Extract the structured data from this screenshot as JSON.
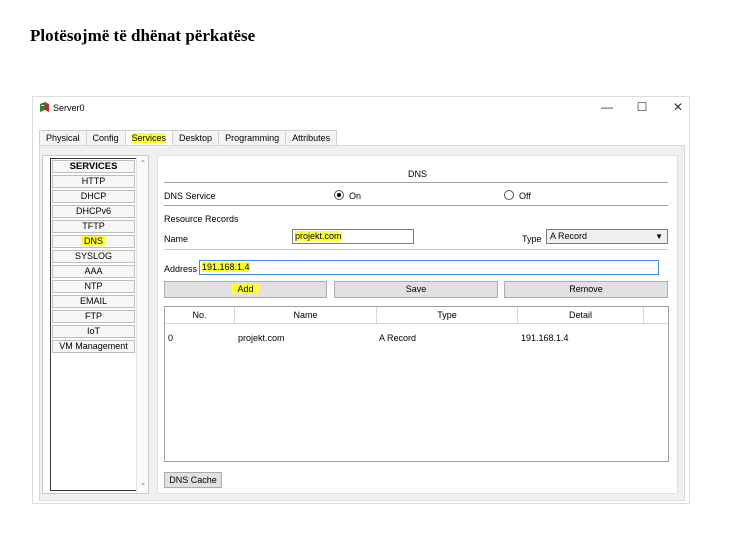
{
  "heading": "Plotësojmë të dhënat përkatëse",
  "window": {
    "title": "Server0",
    "minimize": "—",
    "maximize": "☐",
    "close": "✕"
  },
  "tabs": [
    "Physical",
    "Config",
    "Services",
    "Desktop",
    "Programming",
    "Attributes"
  ],
  "active_tab": "Services",
  "services": {
    "header": "SERVICES",
    "items": [
      "HTTP",
      "DHCP",
      "DHCPv6",
      "TFTP",
      "DNS",
      "SYSLOG",
      "AAA",
      "NTP",
      "EMAIL",
      "FTP",
      "IoT",
      "VM Management"
    ],
    "selected": "DNS"
  },
  "dns": {
    "title": "DNS",
    "service_label": "DNS Service",
    "on_label": "On",
    "off_label": "Off",
    "state": "On",
    "resource_records_label": "Resource Records",
    "name_label": "Name",
    "name_value": "projekt.com",
    "type_label": "Type",
    "type_value": "A Record",
    "address_label": "Address",
    "address_value": "191.168.1.4",
    "add_button": "Add",
    "save_button": "Save",
    "remove_button": "Remove",
    "table": {
      "columns": [
        "No.",
        "Name",
        "Type",
        "Detail"
      ],
      "rows": [
        [
          "0",
          "projekt.com",
          "A Record",
          "191.168.1.4"
        ]
      ]
    },
    "cache_button": "DNS Cache"
  },
  "colors": {
    "highlight": "#ffff33",
    "panel_bg": "#f0f0f0",
    "button_bg": "#e1e1e1",
    "focus_border": "#3c8ce8"
  }
}
